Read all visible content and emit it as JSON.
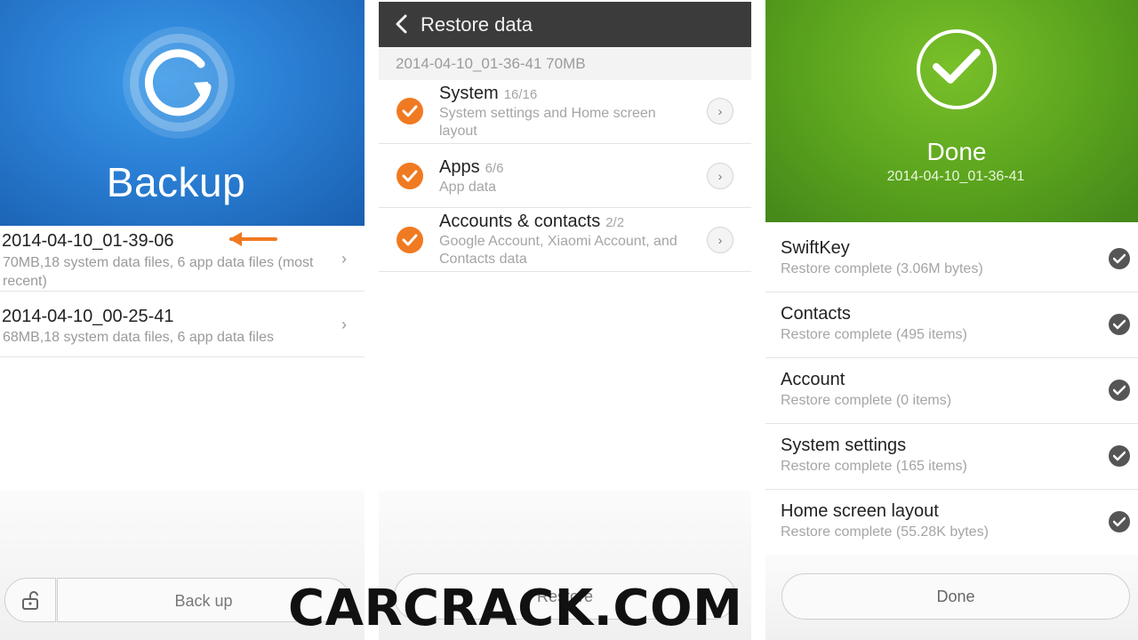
{
  "backup_screen": {
    "title": "Backup",
    "backups": [
      {
        "name": "2014-04-10_01-39-06",
        "description": "70MB,18  system data files, 6  app data files (most recent)"
      },
      {
        "name": "2014-04-10_00-25-41",
        "description": "68MB,18  system data files, 6  app data files"
      }
    ],
    "backup_button_label": "Back up"
  },
  "restore_screen": {
    "title": "Restore data",
    "subtitle": "2014-04-10_01-36-41   70MB",
    "items": [
      {
        "name": "System",
        "count": "16/16",
        "description": "System settings and Home screen layout"
      },
      {
        "name": "Apps",
        "count": "6/6",
        "description": "App data"
      },
      {
        "name": "Accounts & contacts",
        "count": "2/2",
        "description": "Google Account, Xiaomi Account, and Contacts data"
      }
    ],
    "restore_button_label": "Restore"
  },
  "done_screen": {
    "title": "Done",
    "date": "2014-04-10_01-36-41",
    "results": [
      {
        "name": "SwiftKey",
        "status": "Restore complete (3.06M  bytes)"
      },
      {
        "name": "Contacts",
        "status": "Restore complete (495  items)"
      },
      {
        "name": "Account",
        "status": "Restore complete (0  items)"
      },
      {
        "name": "System settings",
        "status": "Restore complete (165  items)"
      },
      {
        "name": "Home screen layout",
        "status": "Restore complete (55.28K  bytes)"
      }
    ],
    "done_button_label": "Done"
  },
  "watermark": "CARCRACK.COM",
  "colors": {
    "backup_blue": "#2a7fd4",
    "header_dark": "#3b3b3b",
    "check_orange": "#f07a21",
    "done_green": "#5da61e",
    "annotation_arrow": "#f07a21"
  },
  "icons": {
    "backup_logo": "circular-arrow-icon",
    "lock": "unlock-icon",
    "back": "chevron-left-icon",
    "row_more": "chevron-right-icon",
    "item_check": "checkmark-icon",
    "done_mark": "check-circle-icon"
  }
}
